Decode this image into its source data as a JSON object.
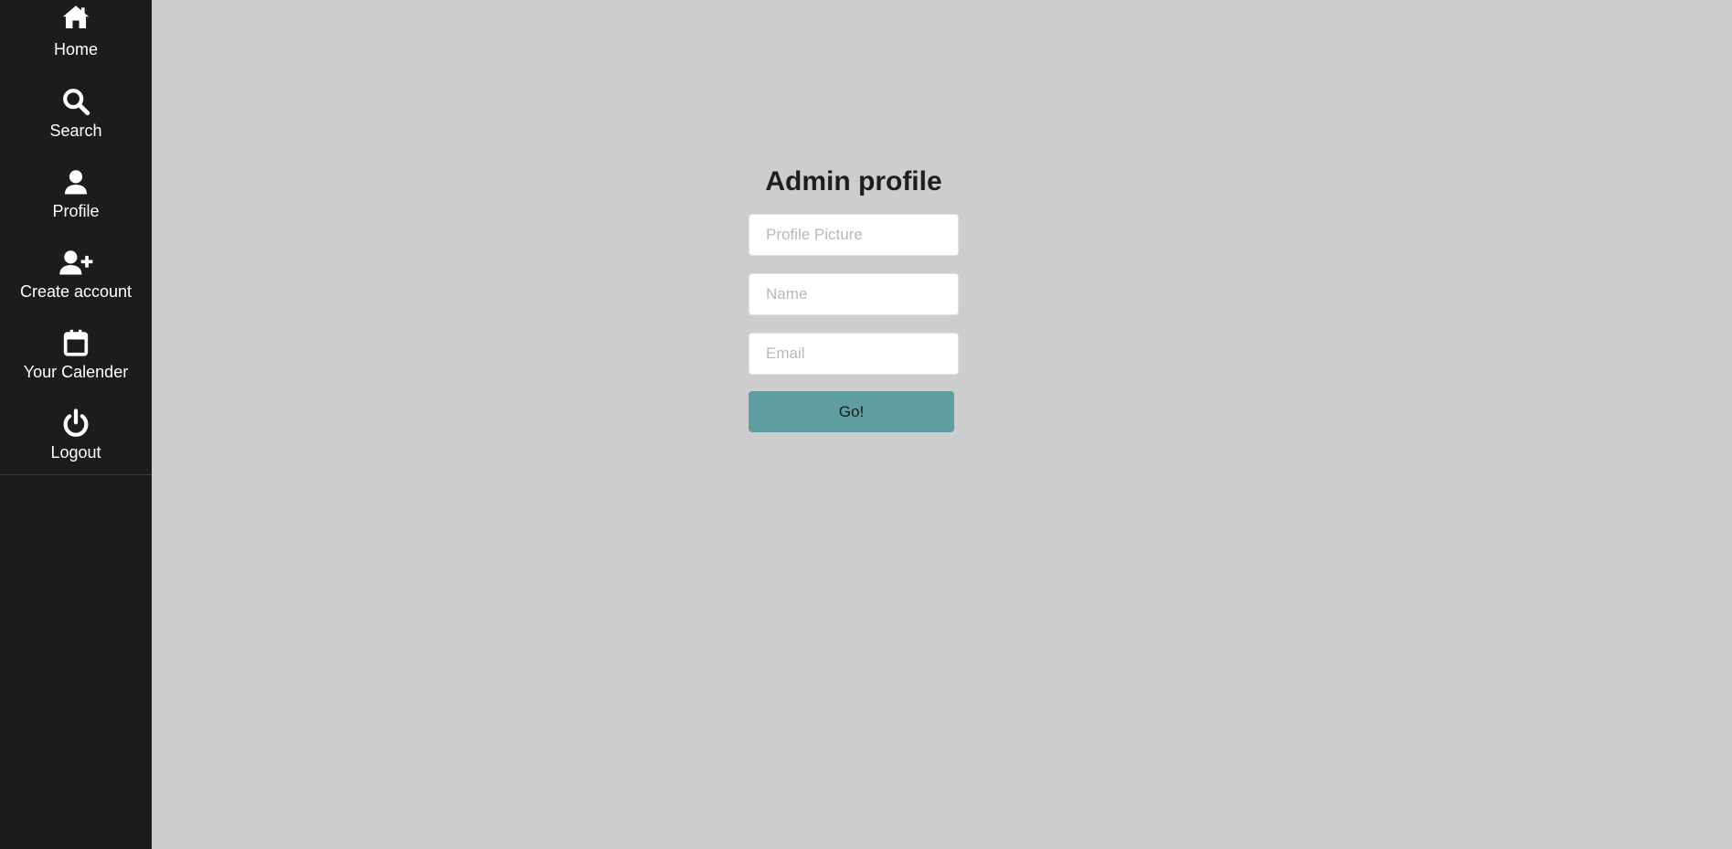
{
  "sidebar": {
    "items": [
      {
        "label": "Home",
        "icon": "home-icon"
      },
      {
        "label": "Search",
        "icon": "search-icon"
      },
      {
        "label": "Profile",
        "icon": "user-icon"
      },
      {
        "label": "Create account",
        "icon": "user-plus-icon"
      },
      {
        "label": "Your Calender",
        "icon": "calendar-icon"
      },
      {
        "label": "Logout",
        "icon": "power-icon"
      }
    ]
  },
  "main": {
    "title": "Admin profile",
    "fields": {
      "profile_picture": {
        "value": "",
        "placeholder": "Profile Picture"
      },
      "name": {
        "value": "",
        "placeholder": "Name"
      },
      "email": {
        "value": "",
        "placeholder": "Email"
      }
    },
    "submit_label": "Go!"
  },
  "colors": {
    "sidebar_bg": "#1b1c1e",
    "main_bg": "#cdcdcd",
    "button_bg": "#5f9ea0",
    "title_text": "#1e1e1e",
    "placeholder_text": "#b9b9b9"
  }
}
